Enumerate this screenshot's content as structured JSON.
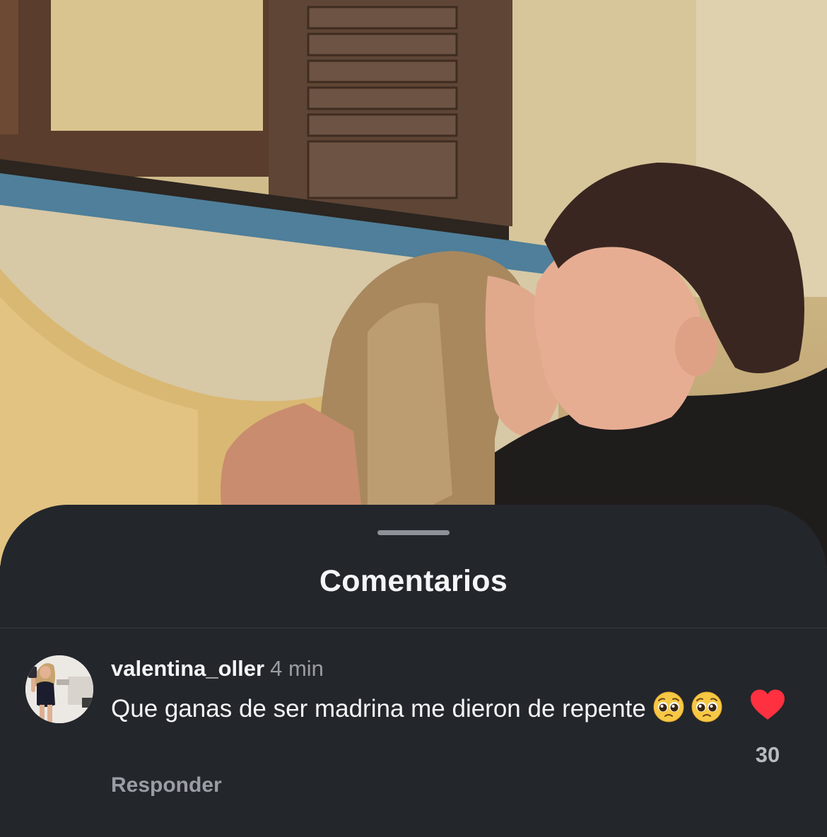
{
  "sheet": {
    "title": "Comentarios"
  },
  "comment": {
    "username": "valentina_oller",
    "timestamp": "4 min",
    "text": "Que ganas de ser madrina me dieron de repente",
    "emojis": [
      "pleading-face-emoji",
      "pleading-face-emoji"
    ],
    "reply_label": "Responder",
    "like_count": "30",
    "liked": true
  },
  "colors": {
    "sheet_background": "#23262b",
    "primary_text": "#f4f5f6",
    "secondary_text": "#9a9da3",
    "like_red": "#ff3040"
  }
}
